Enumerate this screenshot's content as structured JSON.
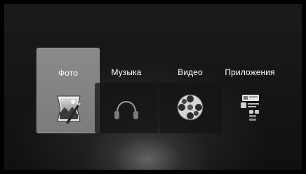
{
  "menu": {
    "items": [
      {
        "label": "Фото",
        "icon": "photo-icon"
      },
      {
        "label": "Музыка",
        "icon": "music-icon"
      },
      {
        "label": "Видео",
        "icon": "video-reel-icon"
      },
      {
        "label": "Приложения",
        "icon": "apps-icon"
      }
    ],
    "selected_index": 0
  }
}
